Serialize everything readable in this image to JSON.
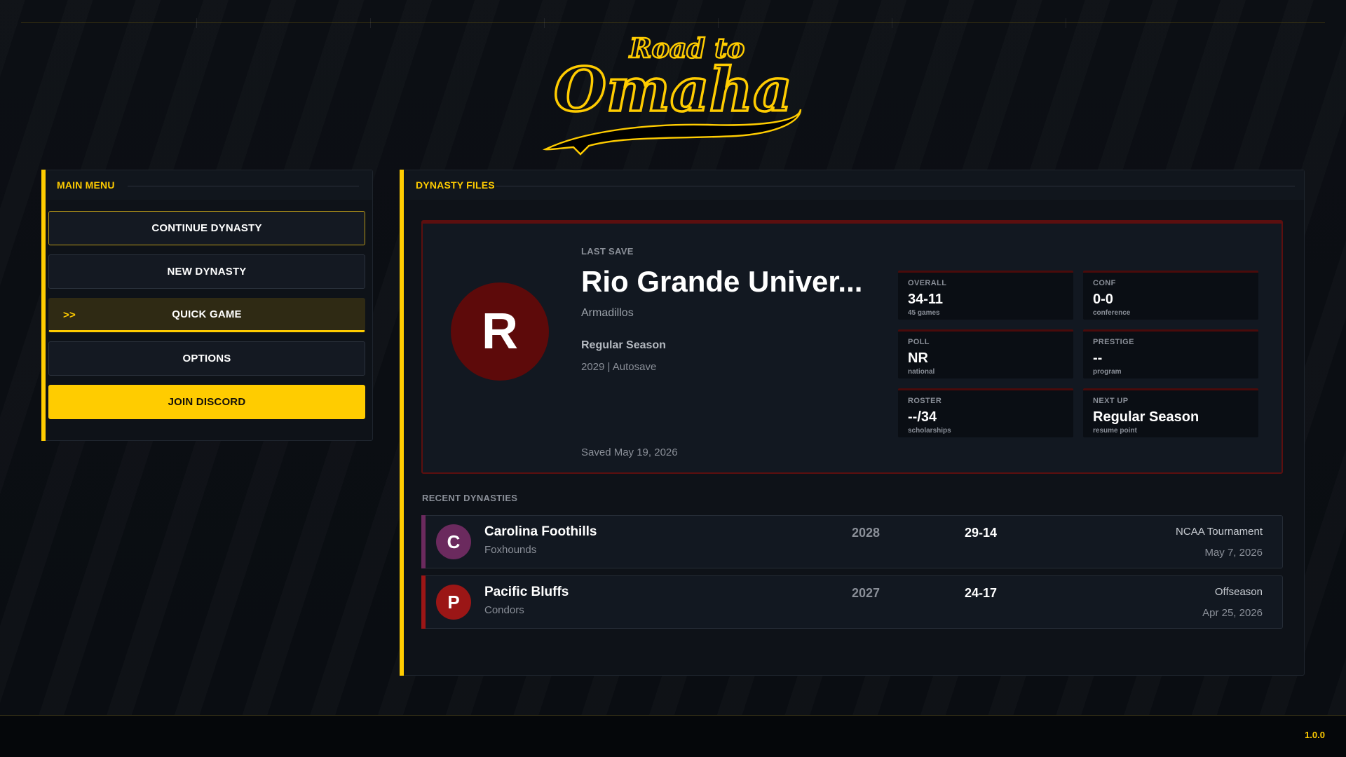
{
  "app": {
    "logo_top": "Road to",
    "logo_main": "Omaha",
    "version": "1.0.0"
  },
  "main_menu": {
    "title": "MAIN MENU",
    "selected_marker": ">>",
    "items": [
      {
        "label": "CONTINUE DYNASTY",
        "state": "focused"
      },
      {
        "label": "NEW DYNASTY",
        "state": "normal"
      },
      {
        "label": "QUICK GAME",
        "state": "selected"
      },
      {
        "label": "OPTIONS",
        "state": "normal"
      },
      {
        "label": "JOIN DISCORD",
        "state": "primary"
      }
    ]
  },
  "dynasty_files": {
    "title": "DYNASTY FILES",
    "last_save": {
      "section_label": "LAST SAVE",
      "team_initial": "R",
      "team_name": "Rio Grande Univer...",
      "mascot": "Armadillos",
      "phase": "Regular Season",
      "year_slot": "2029 | Autosave",
      "saved_at": "Saved May 19, 2026",
      "avatar_color": "#5d0a0a",
      "accent_color": "#5c0f0f",
      "stats": [
        {
          "label": "OVERALL",
          "value": "34-11",
          "sub": "45 games"
        },
        {
          "label": "CONF",
          "value": "0-0",
          "sub": "conference"
        },
        {
          "label": "POLL",
          "value": "NR",
          "sub": "national"
        },
        {
          "label": "PRESTIGE",
          "value": "--",
          "sub": "program"
        },
        {
          "label": "ROSTER",
          "value": "--/34",
          "sub": "scholarships"
        },
        {
          "label": "NEXT UP",
          "value": "Regular Season",
          "sub": "resume point"
        }
      ]
    },
    "recent_label": "RECENT DYNASTIES",
    "recent": [
      {
        "initial": "C",
        "name": "Carolina Foothills",
        "mascot": "Foxhounds",
        "year": "2028",
        "record": "29-14",
        "stage": "NCAA Tournament",
        "date": "May 7, 2026",
        "color": "#6b2a5e"
      },
      {
        "initial": "P",
        "name": "Pacific Bluffs",
        "mascot": "Condors",
        "year": "2027",
        "record": "24-17",
        "stage": "Offseason",
        "date": "Apr 25, 2026",
        "color": "#9b1616"
      }
    ]
  },
  "colors": {
    "accent": "#ffcc00",
    "background": "#0b0e13",
    "panel": "#0e1218"
  }
}
